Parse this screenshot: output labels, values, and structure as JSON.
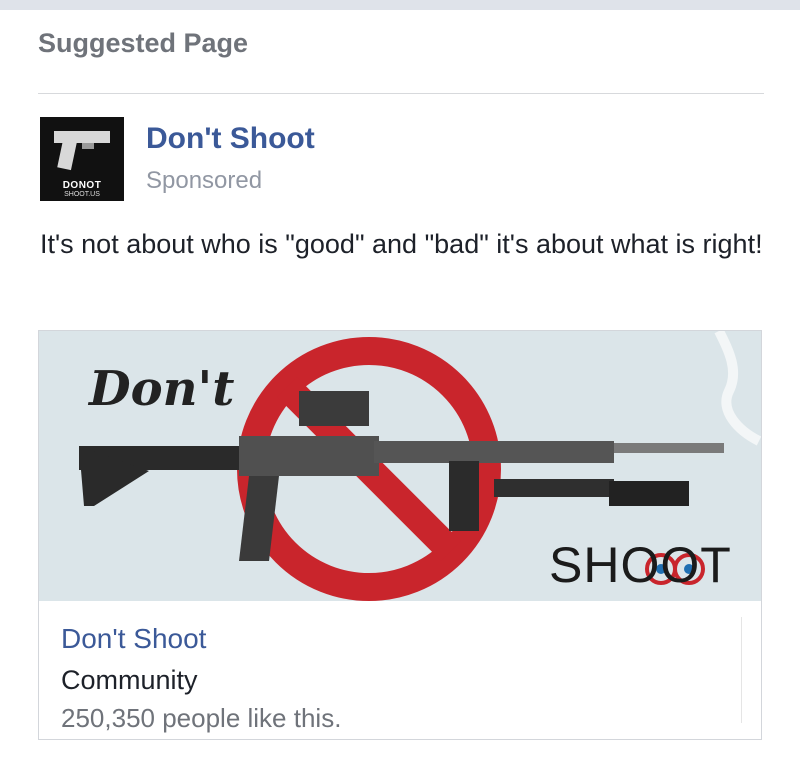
{
  "header": {
    "title": "Suggested Page"
  },
  "post": {
    "page_name": "Don't Shoot",
    "sponsored": "Sponsored",
    "text": "It's not about who is \"good\" and \"bad\" it's about what is right!",
    "avatar": {
      "line1": "DONOT",
      "line2": "SHOOT.US"
    }
  },
  "ad": {
    "image_text_top": "Don't",
    "image_text_bottom": "SHOOT",
    "title": "Don't Shoot",
    "category": "Community",
    "likes": "250,350 people like this."
  },
  "colors": {
    "link_blue": "#3b5998",
    "muted_gray": "#9197a3",
    "prohibition_red": "#c9252c",
    "image_bg": "#dce6ea"
  }
}
